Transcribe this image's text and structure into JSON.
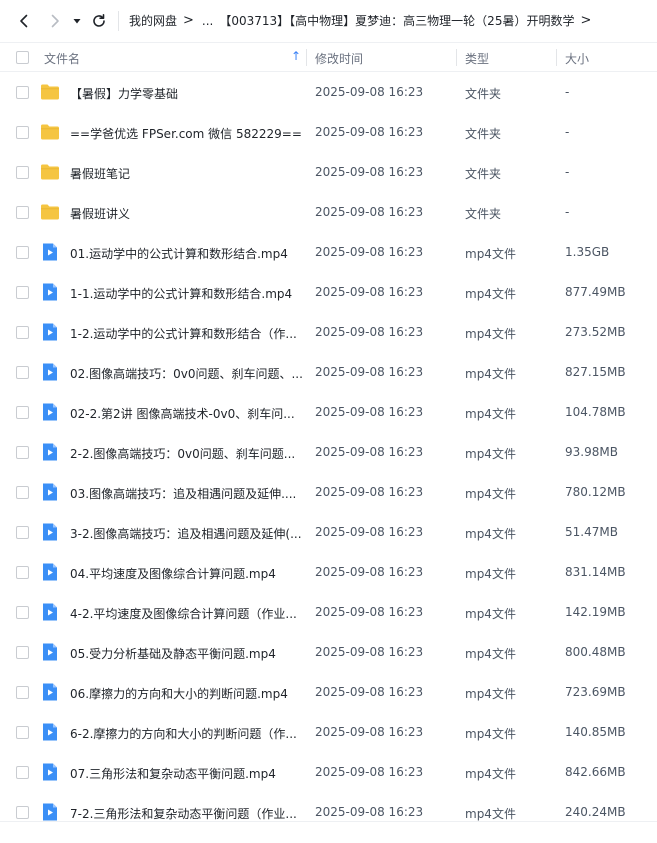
{
  "nav": {
    "back_icon": "chevron-left-icon",
    "forward_icon": "chevron-right-icon",
    "history_icon": "caret-down-icon",
    "refresh_icon": "refresh-icon"
  },
  "breadcrumb": {
    "root": "我的网盘",
    "ellipsis": "...",
    "current": "【003713】【高中物理】夏梦迪：高三物理一轮（25暑）开明数学"
  },
  "table": {
    "headers": {
      "name": "文件名",
      "modified": "修改时间",
      "type": "类型",
      "size": "大小"
    },
    "rows": [
      {
        "name": "【暑假】力学零基础",
        "time": "2025-09-08 16:23",
        "type": "文件夹",
        "size": "-",
        "kind": "folder"
      },
      {
        "name": "==学爸优选 FPSer.com 微信 582229==",
        "time": "2025-09-08 16:23",
        "type": "文件夹",
        "size": "-",
        "kind": "folder"
      },
      {
        "name": "暑假班笔记",
        "time": "2025-09-08 16:23",
        "type": "文件夹",
        "size": "-",
        "kind": "folder"
      },
      {
        "name": "暑假班讲义",
        "time": "2025-09-08 16:23",
        "type": "文件夹",
        "size": "-",
        "kind": "folder"
      },
      {
        "name": "01.运动学中的公式计算和数形结合.mp4",
        "time": "2025-09-08 16:23",
        "type": "mp4文件",
        "size": "1.35GB",
        "kind": "video"
      },
      {
        "name": "1-1.运动学中的公式计算和数形结合.mp4",
        "time": "2025-09-08 16:23",
        "type": "mp4文件",
        "size": "877.49MB",
        "kind": "video"
      },
      {
        "name": "1-2.运动学中的公式计算和数形结合（作...",
        "time": "2025-09-08 16:23",
        "type": "mp4文件",
        "size": "273.52MB",
        "kind": "video"
      },
      {
        "name": "02.图像高端技巧：0v0问题、刹车问题、...",
        "time": "2025-09-08 16:23",
        "type": "mp4文件",
        "size": "827.15MB",
        "kind": "video"
      },
      {
        "name": "02-2.第2讲 图像高端技术-0v0、刹车问...",
        "time": "2025-09-08 16:23",
        "type": "mp4文件",
        "size": "104.78MB",
        "kind": "video"
      },
      {
        "name": "2-2.图像高端技巧：0v0问题、刹车问题...",
        "time": "2025-09-08 16:23",
        "type": "mp4文件",
        "size": "93.98MB",
        "kind": "video"
      },
      {
        "name": "03.图像高端技巧：追及相遇问题及延伸....",
        "time": "2025-09-08 16:23",
        "type": "mp4文件",
        "size": "780.12MB",
        "kind": "video"
      },
      {
        "name": "3-2.图像高端技巧：追及相遇问题及延伸(...",
        "time": "2025-09-08 16:23",
        "type": "mp4文件",
        "size": "51.47MB",
        "kind": "video"
      },
      {
        "name": "04.平均速度及图像综合计算问题.mp4",
        "time": "2025-09-08 16:23",
        "type": "mp4文件",
        "size": "831.14MB",
        "kind": "video"
      },
      {
        "name": "4-2.平均速度及图像综合计算问题（作业...",
        "time": "2025-09-08 16:23",
        "type": "mp4文件",
        "size": "142.19MB",
        "kind": "video"
      },
      {
        "name": "05.受力分析基础及静态平衡问题.mp4",
        "time": "2025-09-08 16:23",
        "type": "mp4文件",
        "size": "800.48MB",
        "kind": "video"
      },
      {
        "name": "06.摩擦力的方向和大小的判断问题.mp4",
        "time": "2025-09-08 16:23",
        "type": "mp4文件",
        "size": "723.69MB",
        "kind": "video"
      },
      {
        "name": "6-2.摩擦力的方向和大小的判断问题（作...",
        "time": "2025-09-08 16:23",
        "type": "mp4文件",
        "size": "140.85MB",
        "kind": "video"
      },
      {
        "name": "07.三角形法和复杂动态平衡问题.mp4",
        "time": "2025-09-08 16:23",
        "type": "mp4文件",
        "size": "842.66MB",
        "kind": "video"
      },
      {
        "name": "7-2.三角形法和复杂动态平衡问题（作业...",
        "time": "2025-09-08 16:23",
        "type": "mp4文件",
        "size": "240.24MB",
        "kind": "video"
      }
    ]
  },
  "colors": {
    "folder": "#f5c542",
    "video": "#3b8ff6",
    "sort_arrow": "#3b82f6"
  }
}
